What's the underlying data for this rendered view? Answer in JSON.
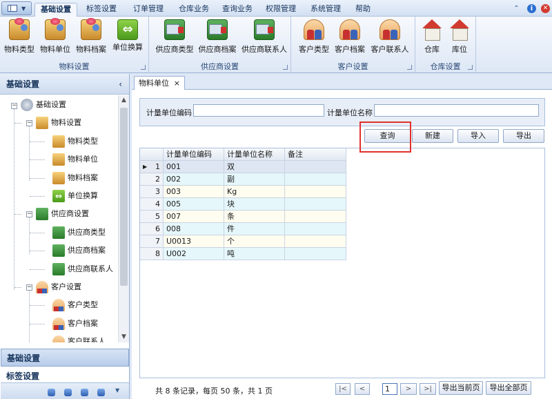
{
  "menu": {
    "tabs": [
      "基础设置",
      "标签设置",
      "订单管理",
      "仓库业务",
      "查询业务",
      "权限管理",
      "系统管理",
      "帮助"
    ],
    "active_tab": "基础设置"
  },
  "ribbon": {
    "groups": [
      {
        "label": "物料设置",
        "buttons": [
          "物料类型",
          "物料单位",
          "物料档案",
          "单位换算"
        ]
      },
      {
        "label": "供应商设置",
        "buttons": [
          "供应商类型",
          "供应商档案",
          "供应商联系人"
        ]
      },
      {
        "label": "客户设置",
        "buttons": [
          "客户类型",
          "客户档案",
          "客户联系人"
        ]
      },
      {
        "label": "仓库设置",
        "buttons": [
          "仓库",
          "库位"
        ]
      }
    ]
  },
  "left_panel": {
    "title": "基础设置",
    "collapse_glyph": "‹",
    "tree": {
      "root": "基础设置",
      "material_group": "物料设置",
      "material_items": [
        "物料类型",
        "物料单位",
        "物料档案",
        "单位换算"
      ],
      "supplier_group": "供应商设置",
      "supplier_items": [
        "供应商类型",
        "供应商档案",
        "供应商联系人"
      ],
      "customer_group": "客户设置",
      "customer_items": [
        "客户类型",
        "客户档案",
        "客户联系人"
      ]
    },
    "nav_buttons": [
      "基础设置",
      "标签设置"
    ],
    "active_nav": "基础设置"
  },
  "doc_tab": {
    "label": "物料单位",
    "close_glyph": "×"
  },
  "filter": {
    "code_label": "计量单位编码",
    "code_value": "",
    "name_label": "计量单位名称",
    "name_value": ""
  },
  "actions": {
    "query": "查询",
    "new": "新建",
    "import": "导入",
    "export": "导出"
  },
  "grid": {
    "columns": [
      "计量单位编码",
      "计量单位名称",
      "备注"
    ],
    "rows": [
      {
        "num": "1",
        "code": "001",
        "name": "双",
        "note": ""
      },
      {
        "num": "2",
        "code": "002",
        "name": "副",
        "note": ""
      },
      {
        "num": "3",
        "code": "003",
        "name": "Kg",
        "note": ""
      },
      {
        "num": "4",
        "code": "005",
        "name": "块",
        "note": ""
      },
      {
        "num": "5",
        "code": "007",
        "name": "条",
        "note": ""
      },
      {
        "num": "6",
        "code": "008",
        "name": "件",
        "note": ""
      },
      {
        "num": "7",
        "code": "U0013",
        "name": "个",
        "note": ""
      },
      {
        "num": "8",
        "code": "U002",
        "name": "吨",
        "note": ""
      }
    ],
    "selected_row": 1
  },
  "pager": {
    "summary": "共 8 条记录，每页 50 条，共 1 页",
    "first": "|<",
    "prev": "<",
    "page": "1",
    "next": ">",
    "last": ">|",
    "export_page": "导出当前页",
    "export_all": "导出全部页"
  },
  "colors": {
    "highlight": "#e0312b",
    "accent": "#15325a"
  }
}
